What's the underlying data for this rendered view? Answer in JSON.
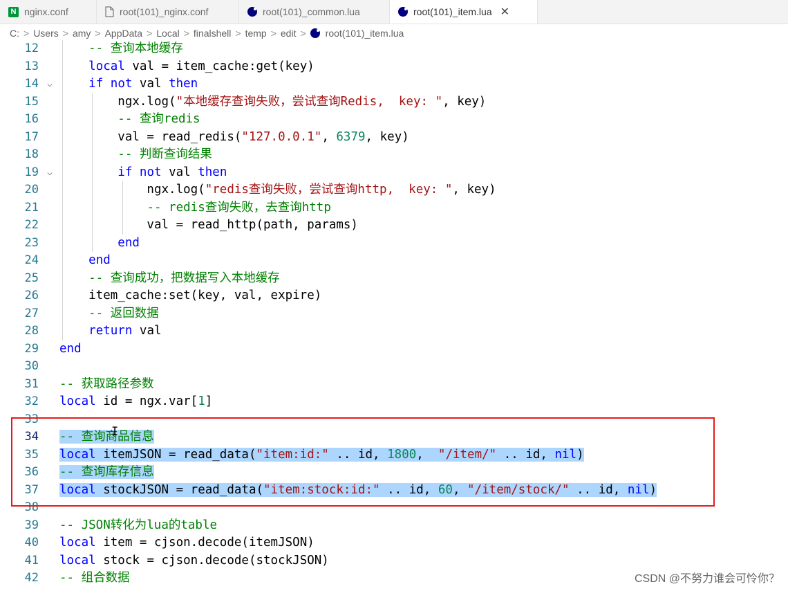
{
  "tabs": [
    {
      "label": "nginx.conf",
      "icon": "nginx-icon",
      "active": false
    },
    {
      "label": "root(101)_nginx.conf",
      "icon": "file-icon",
      "active": false
    },
    {
      "label": "root(101)_common.lua",
      "icon": "lua-icon",
      "active": false
    },
    {
      "label": "root(101)_item.lua",
      "icon": "lua-icon",
      "active": true,
      "close": "✕"
    }
  ],
  "breadcrumb": {
    "items": [
      "C:",
      "Users",
      "amy",
      "AppData",
      "Local",
      "finalshell",
      "temp",
      "edit"
    ],
    "file": "root(101)_item.lua",
    "separator": ">"
  },
  "editor": {
    "lines": [
      {
        "n": "12",
        "text": "    -- 查询本地缓存"
      },
      {
        "n": "13",
        "text": "    local val = item_cache:get(key)"
      },
      {
        "n": "14",
        "text": "    if not val then",
        "fold": true
      },
      {
        "n": "15",
        "text": "        ngx.log(\"本地缓存查询失败，尝试查询Redis,  key: \", key)"
      },
      {
        "n": "16",
        "text": "        -- 查询redis"
      },
      {
        "n": "17",
        "text": "        val = read_redis(\"127.0.0.1\", 6379, key)"
      },
      {
        "n": "18",
        "text": "        -- 判断查询结果"
      },
      {
        "n": "19",
        "text": "        if not val then",
        "fold": true
      },
      {
        "n": "20",
        "text": "            ngx.log(\"redis查询失败，尝试查询http,  key: \", key)"
      },
      {
        "n": "21",
        "text": "            -- redis查询失败，去查询http"
      },
      {
        "n": "22",
        "text": "            val = read_http(path, params)"
      },
      {
        "n": "23",
        "text": "        end"
      },
      {
        "n": "24",
        "text": "    end"
      },
      {
        "n": "25",
        "text": "    -- 查询成功，把数据写入本地缓存"
      },
      {
        "n": "26",
        "text": "    item_cache:set(key, val, expire)"
      },
      {
        "n": "27",
        "text": "    -- 返回数据"
      },
      {
        "n": "28",
        "text": "    return val"
      },
      {
        "n": "29",
        "text": "end"
      },
      {
        "n": "30",
        "text": ""
      },
      {
        "n": "31",
        "text": "-- 获取路径参数"
      },
      {
        "n": "32",
        "text": "local id = ngx.var[1]"
      },
      {
        "n": "33",
        "text": ""
      },
      {
        "n": "34",
        "text": "-- 查询商品信息",
        "selected": true
      },
      {
        "n": "35",
        "text": "local itemJSON = read_data(\"item:id:\" .. id, 1800,  \"/item/\" .. id, nil)",
        "selected": true
      },
      {
        "n": "36",
        "text": "-- 查询库存信息",
        "selected": true
      },
      {
        "n": "37",
        "text": "local stockJSON = read_data(\"item:stock:id:\" .. id, 60, \"/item/stock/\" .. id, nil)",
        "selected": true
      },
      {
        "n": "38",
        "text": ""
      },
      {
        "n": "39",
        "text": "-- JSON转化为lua的table"
      },
      {
        "n": "40",
        "text": "local item = cjson.decode(itemJSON)"
      },
      {
        "n": "41",
        "text": "local stock = cjson.decode(stockJSON)"
      },
      {
        "n": "42",
        "text": "-- 组合数据"
      }
    ],
    "text_cursor": "I"
  },
  "watermark": "CSDN @不努力谁会可怜你？",
  "colors": {
    "keyword": "#0000ff",
    "comment": "#008000",
    "string": "#a31515",
    "number": "#098658",
    "selection": "#add6ff",
    "highlight_box": "#e31b1b"
  }
}
